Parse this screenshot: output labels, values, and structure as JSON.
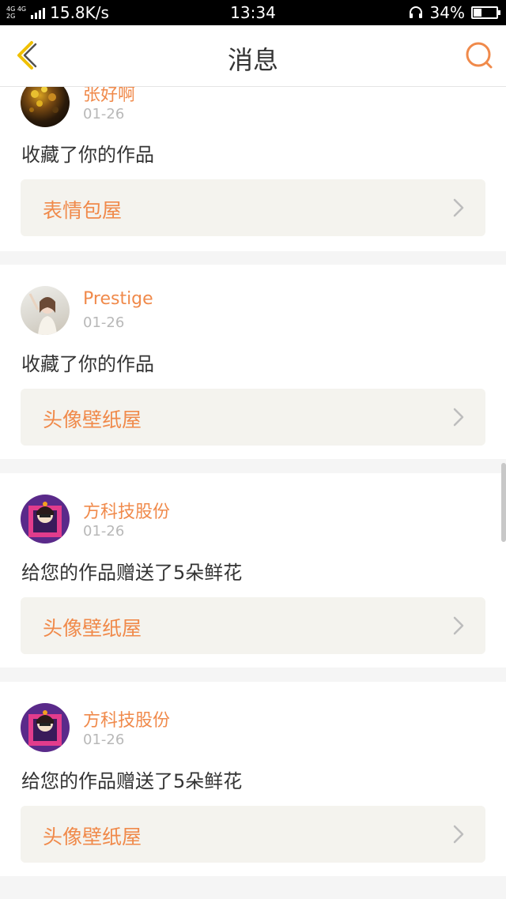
{
  "status_bar": {
    "network_top": "4G 4G",
    "network_bottom": "2G",
    "speed": "15.8K/s",
    "time": "13:34",
    "battery": "34%",
    "battery_level": 0.34
  },
  "nav": {
    "title": "消息",
    "back_icon": "chevron-left-icon",
    "search_icon": "search-icon"
  },
  "colors": {
    "accent": "#f08a4b",
    "back_icon": "#f0c000",
    "link_box_bg": "#f4f3ee",
    "page_bg": "#f5f5f5"
  },
  "messages": [
    {
      "username": "张好啊",
      "date": "01-26",
      "action": "收藏了你的作品",
      "link_label": "表情包屋",
      "avatar": "dark-flowers-avatar"
    },
    {
      "username": "Prestige",
      "date": "01-26",
      "action": "收藏了你的作品",
      "link_label": "头像壁纸屋",
      "avatar": "girl-photo-avatar"
    },
    {
      "username": "方科技股份",
      "date": "01-26",
      "action": "给您的作品赠送了5朵鲜花",
      "link_label": "头像壁纸屋",
      "avatar": "cartoon-girl-avatar"
    },
    {
      "username": "方科技股份",
      "date": "01-26",
      "action": "给您的作品赠送了5朵鲜花",
      "link_label": "头像壁纸屋",
      "avatar": "cartoon-girl-avatar"
    }
  ]
}
